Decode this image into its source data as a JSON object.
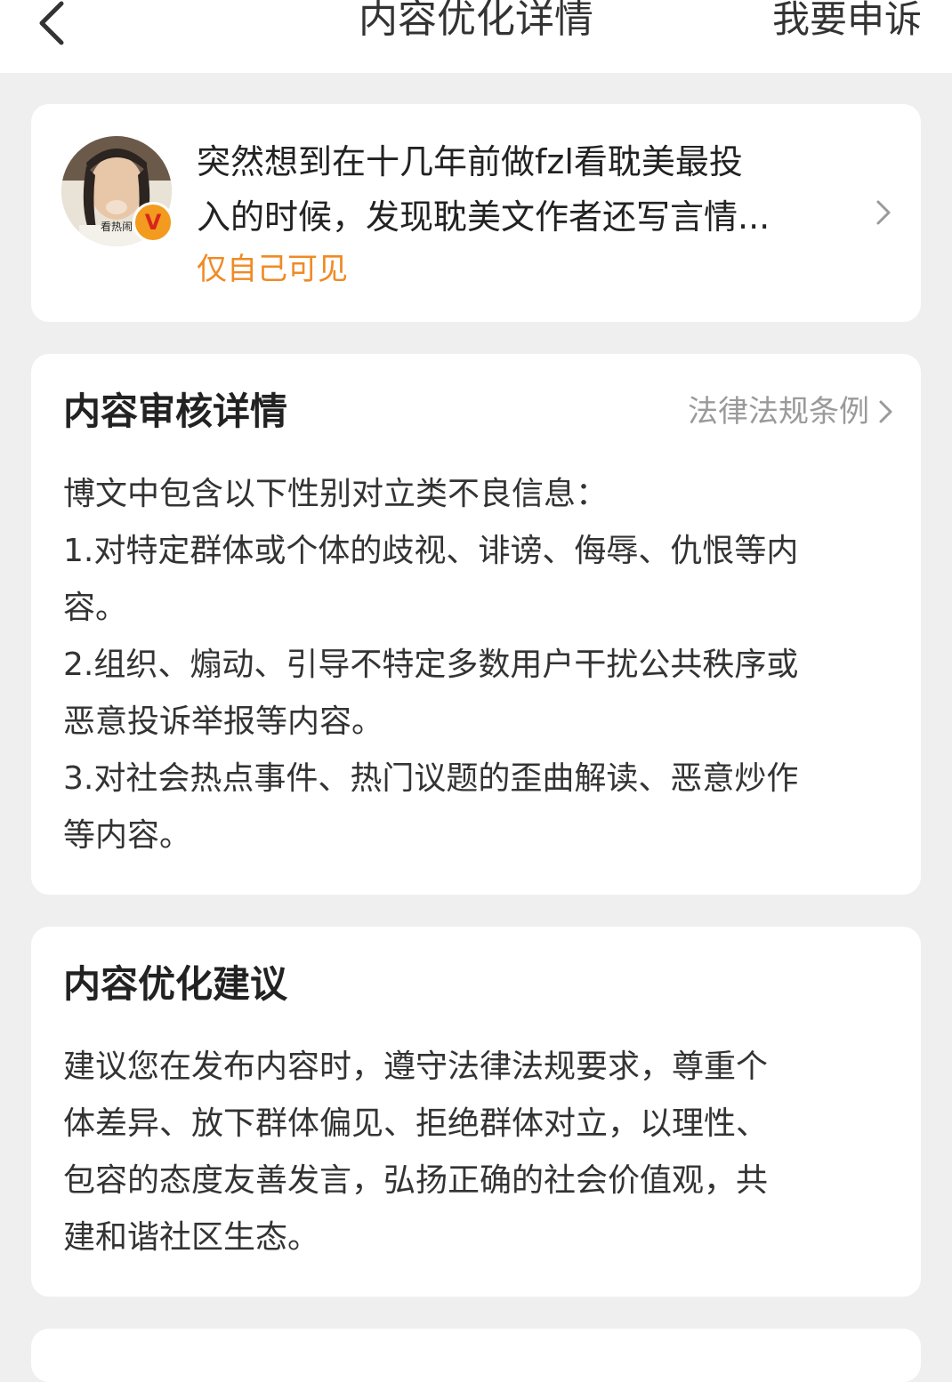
{
  "header": {
    "title": "内容优化详情",
    "appeal_label": "我要申诉"
  },
  "post": {
    "text_line1": "突然想到在十几年前做fzl看耽美最投",
    "text_line2": "入的时候，发现耽美文作者还写言情...",
    "visibility": "仅自己可见",
    "avatar_caption": "看热闹"
  },
  "review": {
    "title": "内容审核详情",
    "law_link": "法律法规条例",
    "lines": [
      "博文中包含以下性别对立类不良信息：",
      "1.对特定群体或个体的歧视、诽谤、侮辱、仇恨等内",
      "容。",
      "2.组织、煽动、引导不特定多数用户干扰公共秩序或",
      "恶意投诉举报等内容。",
      "3.对社会热点事件、热门议题的歪曲解读、恶意炒作",
      "等内容。"
    ]
  },
  "advice": {
    "title": "内容优化建议",
    "lines": [
      "建议您在发布内容时，遵守法律法规要求，尊重个",
      "体差异、放下群体偏见、拒绝群体对立，以理性、",
      "包容的态度友善发言，弘扬正确的社会价值观，共",
      "建和谐社区生态。"
    ]
  },
  "colors": {
    "accent_orange": "#f08a24",
    "badge_orange": "#f39b1f",
    "background": "#efefef",
    "card": "#ffffff",
    "muted_text": "#9a9a9a"
  }
}
